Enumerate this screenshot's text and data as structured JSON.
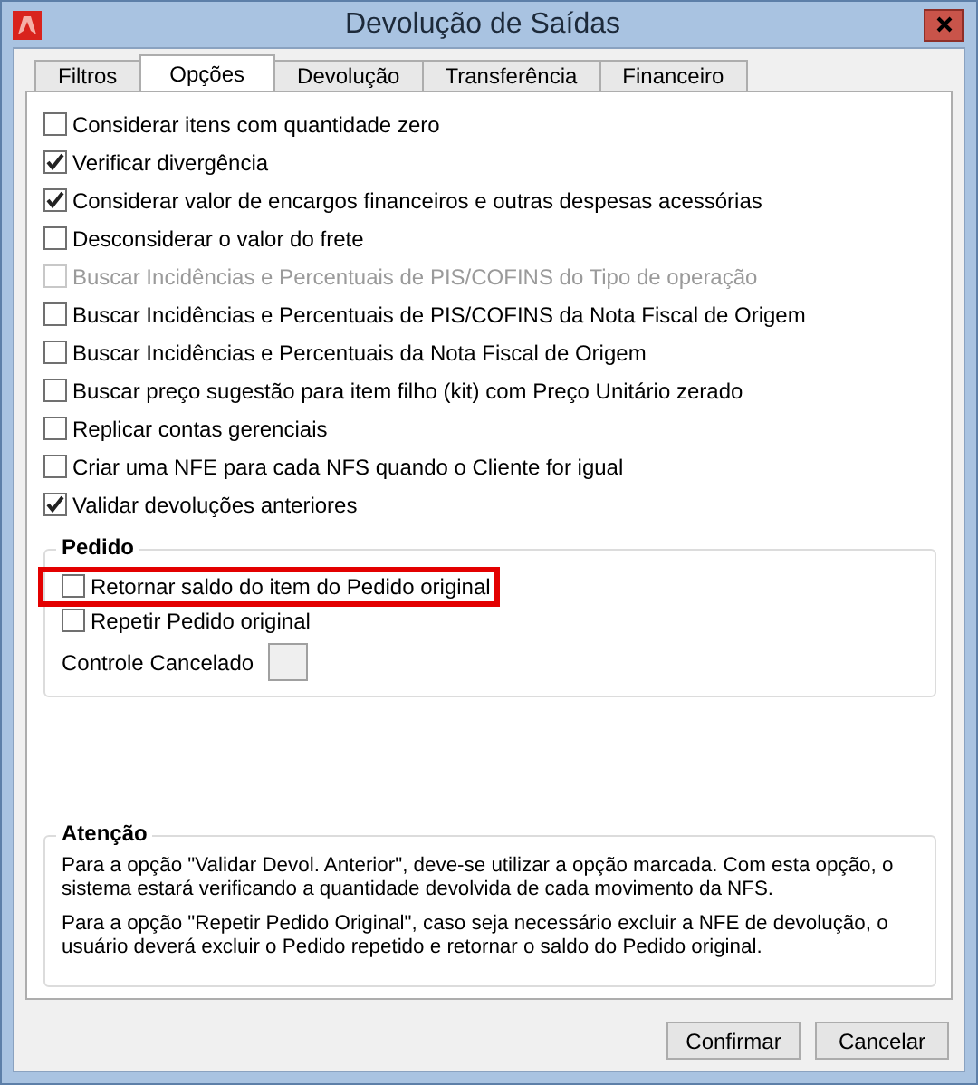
{
  "window": {
    "title": "Devolução de Saídas"
  },
  "tabs": [
    {
      "label": "Filtros",
      "selected": false
    },
    {
      "label": "Opções",
      "selected": true
    },
    {
      "label": "Devolução",
      "selected": false
    },
    {
      "label": "Transferência",
      "selected": false
    },
    {
      "label": "Financeiro",
      "selected": false
    }
  ],
  "options": [
    {
      "label": "Considerar itens com quantidade zero",
      "checked": false,
      "disabled": false
    },
    {
      "label": "Verificar divergência",
      "checked": true,
      "disabled": false
    },
    {
      "label": "Considerar valor de encargos financeiros e outras despesas acessórias",
      "checked": true,
      "disabled": false
    },
    {
      "label": "Desconsiderar o valor do frete",
      "checked": false,
      "disabled": false
    },
    {
      "label": "Buscar Incidências e Percentuais de PIS/COFINS do Tipo de operação",
      "checked": false,
      "disabled": true
    },
    {
      "label": "Buscar Incidências e Percentuais de PIS/COFINS da Nota Fiscal de Origem",
      "checked": false,
      "disabled": false
    },
    {
      "label": "Buscar Incidências e Percentuais da Nota Fiscal de Origem",
      "checked": false,
      "disabled": false
    },
    {
      "label": "Buscar preço sugestão para item filho (kit) com Preço Unitário zerado",
      "checked": false,
      "disabled": false
    },
    {
      "label": "Replicar contas gerenciais",
      "checked": false,
      "disabled": false
    },
    {
      "label": "Criar uma NFE para cada NFS quando o Cliente for igual",
      "checked": false,
      "disabled": false
    },
    {
      "label": "Validar devoluções anteriores",
      "checked": true,
      "disabled": false
    }
  ],
  "pedido": {
    "title": "Pedido",
    "options": [
      {
        "label": "Retornar saldo do item do Pedido original",
        "checked": false,
        "highlighted": true
      },
      {
        "label": "Repetir Pedido original",
        "checked": false,
        "highlighted": false
      }
    ],
    "controle_cancelado": {
      "label": "Controle Cancelado"
    }
  },
  "atencao": {
    "title": "Atenção",
    "paragraphs": [
      "Para a opção \"Validar Devol. Anterior\", deve-se utilizar a opção marcada. Com esta opção, o sistema estará verificando a quantidade devolvida de cada movimento da NFS.",
      "Para a opção \"Repetir Pedido Original\", caso seja necessário excluir a NFE de devolução, o usuário deverá excluir o Pedido repetido e retornar o saldo do Pedido original."
    ]
  },
  "buttons": [
    "Confirmar",
    "Cancelar"
  ]
}
